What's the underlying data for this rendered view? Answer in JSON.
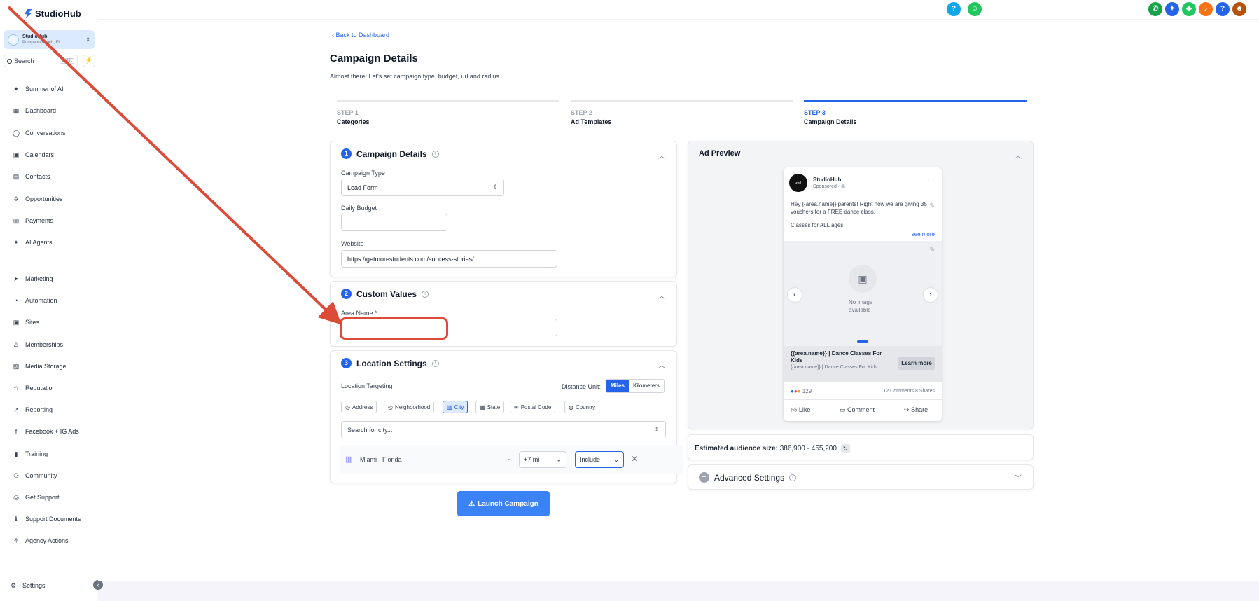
{
  "app": {
    "name": "StudioHub"
  },
  "account": {
    "name": "StudioHub",
    "location": "Pompano Beach, FL"
  },
  "search": {
    "label": "Search",
    "shortcut": "Ctrl K"
  },
  "sidebar": {
    "items": [
      {
        "label": "Summer of AI",
        "icon": "sparkle-icon",
        "glyph": "✦"
      },
      {
        "label": "Dashboard",
        "icon": "dashboard-icon",
        "glyph": "▦"
      },
      {
        "label": "Conversations",
        "icon": "chat-icon",
        "glyph": "◯"
      },
      {
        "label": "Calendars",
        "icon": "calendar-icon",
        "glyph": "▣"
      },
      {
        "label": "Contacts",
        "icon": "contacts-icon",
        "glyph": "▤"
      },
      {
        "label": "Opportunities",
        "icon": "opportunities-icon",
        "glyph": "✲"
      },
      {
        "label": "Payments",
        "icon": "payments-icon",
        "glyph": "▥"
      },
      {
        "label": "AI Agents",
        "icon": "ai-agents-icon",
        "glyph": "✦"
      }
    ],
    "items2": [
      {
        "label": "Marketing",
        "icon": "send-icon",
        "glyph": "➤"
      },
      {
        "label": "Automation",
        "icon": "automation-icon",
        "glyph": "◔"
      },
      {
        "label": "Sites",
        "icon": "sites-icon",
        "glyph": "▣"
      },
      {
        "label": "Memberships",
        "icon": "memberships-icon",
        "glyph": "♙"
      },
      {
        "label": "Media Storage",
        "icon": "media-icon",
        "glyph": "▨"
      },
      {
        "label": "Reputation",
        "icon": "star-icon",
        "glyph": "☆"
      },
      {
        "label": "Reporting",
        "icon": "reporting-icon",
        "glyph": "↗"
      },
      {
        "label": "Facebook + IG Ads",
        "icon": "facebook-icon",
        "glyph": "f"
      },
      {
        "label": "Training",
        "icon": "book-icon",
        "glyph": "▮"
      },
      {
        "label": "Community",
        "icon": "community-icon",
        "glyph": "⚇"
      },
      {
        "label": "Get Support",
        "icon": "support-icon",
        "glyph": "◎"
      },
      {
        "label": "Support Documents",
        "icon": "info-icon",
        "glyph": "ℹ"
      },
      {
        "label": "Agency Actions",
        "icon": "agency-icon",
        "glyph": "⚘"
      }
    ],
    "settings": "Settings"
  },
  "topbar": {
    "icons": [
      {
        "name": "help-icon",
        "glyph": "?",
        "color": "#0ea5e9"
      },
      {
        "name": "bot-icon",
        "glyph": "☺",
        "color": "#22c55e"
      },
      {
        "name": "phone-icon",
        "glyph": "✆",
        "color": "#16a34a"
      },
      {
        "name": "magic-icon",
        "glyph": "✦",
        "color": "#2563eb"
      },
      {
        "name": "megaphone-icon",
        "glyph": "◈",
        "color": "#22c55e"
      },
      {
        "name": "bell-icon",
        "glyph": "♪",
        "color": "#f97316"
      },
      {
        "name": "question-icon",
        "glyph": "?",
        "color": "#2563eb"
      },
      {
        "name": "avatar-icon",
        "glyph": "☻",
        "color": "#b45309"
      }
    ]
  },
  "page": {
    "back": "Back to Dashboard",
    "title": "Campaign Details",
    "subtitle": "Almost there! Let's set campaign type, budget, url and radius."
  },
  "steps": [
    {
      "num": "STEP 1",
      "name": "Categories"
    },
    {
      "num": "STEP 2",
      "name": "Ad Templates"
    },
    {
      "num": "STEP 3",
      "name": "Campaign Details"
    }
  ],
  "campaign": {
    "num": "1",
    "title": "Campaign Details",
    "type_label": "Campaign Type",
    "type_value": "Lead Form",
    "budget_label": "Daily Budget",
    "budget_value": "",
    "website_label": "Website",
    "website_value": "https://getmorestudents.com/success-stories/"
  },
  "custom": {
    "num": "2",
    "title": "Custom Values",
    "area_label": "Area Name *",
    "area_value": ""
  },
  "location": {
    "num": "3",
    "title": "Location Settings",
    "targeting_label": "Location Targeting",
    "unit_label": "Distance Unit:",
    "unit_miles": "Miles",
    "unit_km": "Kilometers",
    "pills": [
      {
        "label": "Address",
        "icon": "pin-icon",
        "glyph": "◎"
      },
      {
        "label": "Neighborhood",
        "icon": "pin-icon",
        "glyph": "◎"
      },
      {
        "label": "City",
        "icon": "building-icon",
        "glyph": "▥"
      },
      {
        "label": "State",
        "icon": "map-icon",
        "glyph": "▦"
      },
      {
        "label": "Postal Code",
        "icon": "mail-icon",
        "glyph": "✉"
      },
      {
        "label": "Country",
        "icon": "globe-icon",
        "glyph": "◍"
      }
    ],
    "city_placeholder": "Search for city...",
    "row_city": "Miami - Florida",
    "row_radius": "+7 mi",
    "row_mode": "Include"
  },
  "launch": "Launch Campaign",
  "preview": {
    "title": "Ad Preview",
    "page_name": "StudioHub",
    "sponsored": "Sponsored",
    "avatar_text": "GET MORE",
    "body1": "Hey {{area.name}} parents! Right now we are giving 35 vouchers for a FREE dance class.",
    "body2": "Classes for ALL ages.",
    "see_more": "see more",
    "no_image": "No image available",
    "headline": "{{area.name}} | Dance Classes For Kids",
    "desc": "{{area.name}} | Dance Classes For Kids",
    "cta": "Learn more",
    "reactions": "129",
    "stats": "12 Comments 8 Shares",
    "like": "Like",
    "comment": "Comment",
    "share": "Share"
  },
  "audience": {
    "label": "Estimated audience size:",
    "value": "386,900 - 455,200"
  },
  "advanced": {
    "title": "Advanced Settings"
  },
  "colors": {
    "accent": "#2563eb",
    "annotation": "#dc4a38"
  }
}
